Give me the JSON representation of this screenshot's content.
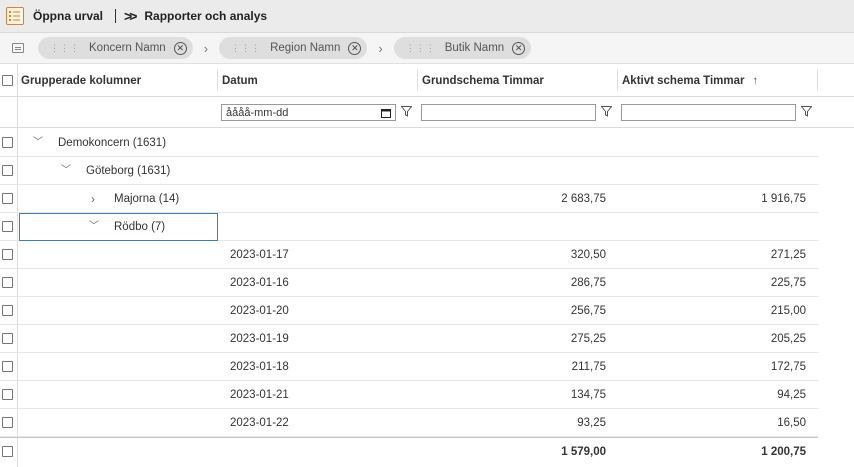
{
  "topbar": {
    "open_label": "Öppna urval",
    "separator": "|",
    "breadcrumb": "Rapporter och analys"
  },
  "groupbar": {
    "chips": [
      {
        "label": "Koncern Namn"
      },
      {
        "label": "Region Namn"
      },
      {
        "label": "Butik Namn"
      }
    ]
  },
  "columns": {
    "group": "Grupperade kolumner",
    "date": "Datum",
    "basic": "Grundschema Timmar",
    "active": "Aktivt schema Timmar",
    "active_sort": "↑"
  },
  "filters": {
    "date_placeholder": "åååå-mm-dd",
    "basic_value": "",
    "active_value": ""
  },
  "tree": {
    "level1": "Demokoncern (1631)",
    "level2": "Göteborg (1631)",
    "level3a": {
      "label": "Majorna (14)",
      "basic": "2 683,75",
      "active": "1 916,75"
    },
    "level3b": "Rödbo (7)"
  },
  "rows": [
    {
      "date": "2023-01-17",
      "basic": "320,50",
      "active": "271,25"
    },
    {
      "date": "2023-01-16",
      "basic": "286,75",
      "active": "225,75"
    },
    {
      "date": "2023-01-20",
      "basic": "256,75",
      "active": "215,00"
    },
    {
      "date": "2023-01-19",
      "basic": "275,25",
      "active": "205,25"
    },
    {
      "date": "2023-01-18",
      "basic": "211,75",
      "active": "172,75"
    },
    {
      "date": "2023-01-21",
      "basic": "134,75",
      "active": "94,25"
    },
    {
      "date": "2023-01-22",
      "basic": "93,25",
      "active": "16,50"
    }
  ],
  "totals": {
    "basic": "1 579,00",
    "active": "1 200,75"
  }
}
